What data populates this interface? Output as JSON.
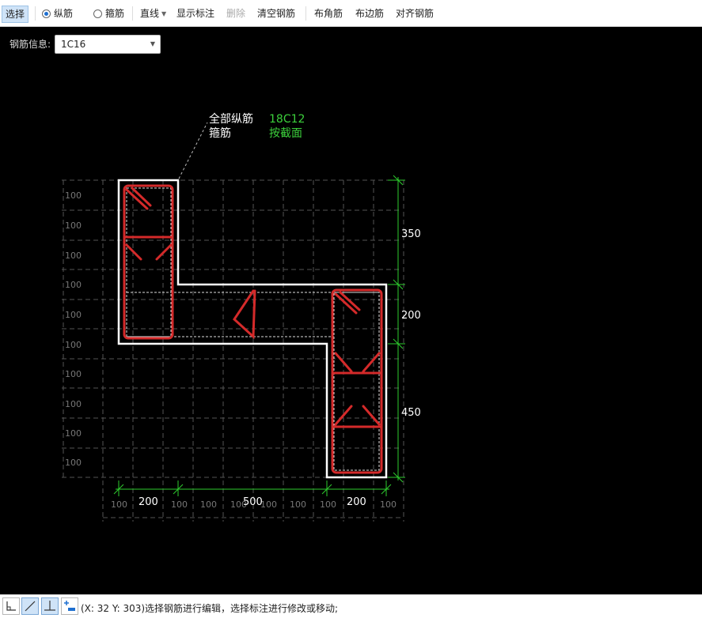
{
  "toolbar": {
    "select": "选择",
    "radio_longitudinal": "纵筋",
    "radio_stirrup": "箍筋",
    "line": "直线",
    "show_dims": "显示标注",
    "delete": "删除",
    "clear_rebar": "清空钢筋",
    "corner_rebar": "布角筋",
    "edge_rebar": "布边筋",
    "align_rebar": "对齐钢筋"
  },
  "info": {
    "label": "钢筋信息:",
    "value": "1C16"
  },
  "annotation": {
    "all_long_label": "全部纵筋",
    "all_long_value": "18C12",
    "stirrup_label": "箍筋",
    "stirrup_value": "按截面"
  },
  "dims": {
    "right": [
      "350",
      "200",
      "450"
    ],
    "bottom": [
      "200",
      "500",
      "200"
    ],
    "grid_label": "100"
  },
  "status": {
    "text": "(X: 32 Y: 303)选择钢筋进行编辑，选择标注进行修改或移动;"
  },
  "colors": {
    "rebar": "#d42a2a",
    "outline": "#ffffff",
    "dimension": "#2ecc2e",
    "grid": "#5a5a5a",
    "annotation_value": "#3cd13c"
  },
  "icons": [
    "corner-snap-icon",
    "diagonal-line-icon",
    "perpendicular-icon",
    "add-dimension-icon",
    "dropdown-arrow-icon"
  ]
}
